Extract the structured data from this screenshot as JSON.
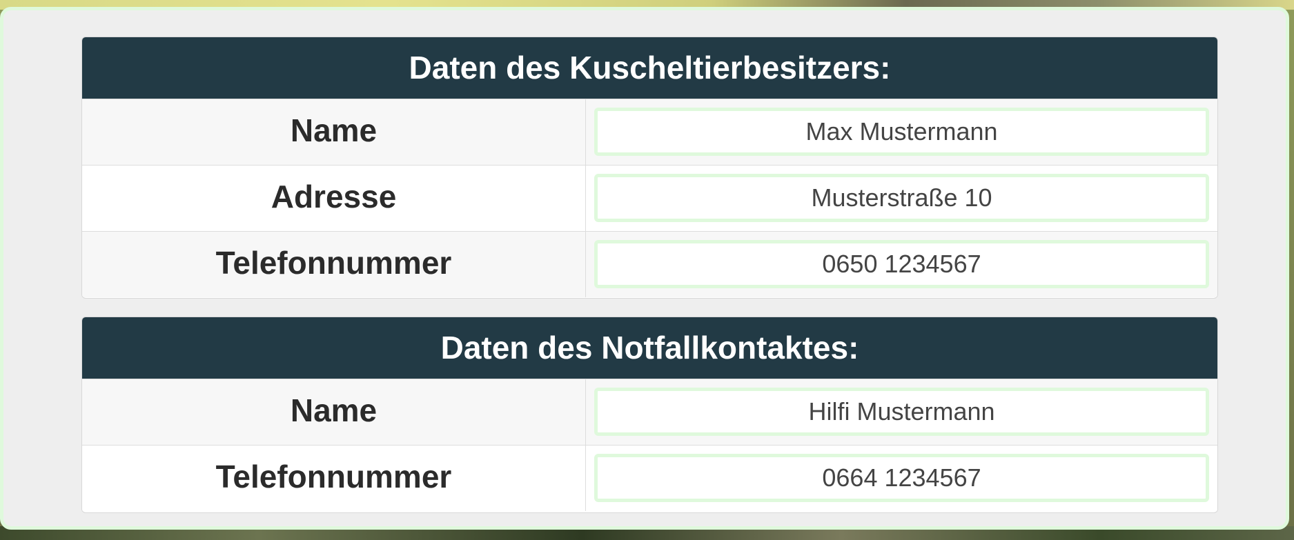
{
  "owner": {
    "title": "Daten des Kuscheltierbesitzers:",
    "rows": [
      {
        "label": "Name",
        "value": "Max Mustermann"
      },
      {
        "label": "Adresse",
        "value": "Musterstraße 10"
      },
      {
        "label": "Telefonnummer",
        "value": "0650 1234567"
      }
    ]
  },
  "emergency": {
    "title": "Daten des Notfallkontaktes:",
    "rows": [
      {
        "label": "Name",
        "value": "Hilfi Mustermann"
      },
      {
        "label": "Telefonnummer",
        "value": "0664 1234567"
      }
    ]
  },
  "colors": {
    "header_bg": "#223a45",
    "panel_border": "#dff9dc",
    "panel_bg": "#eeeeee"
  }
}
